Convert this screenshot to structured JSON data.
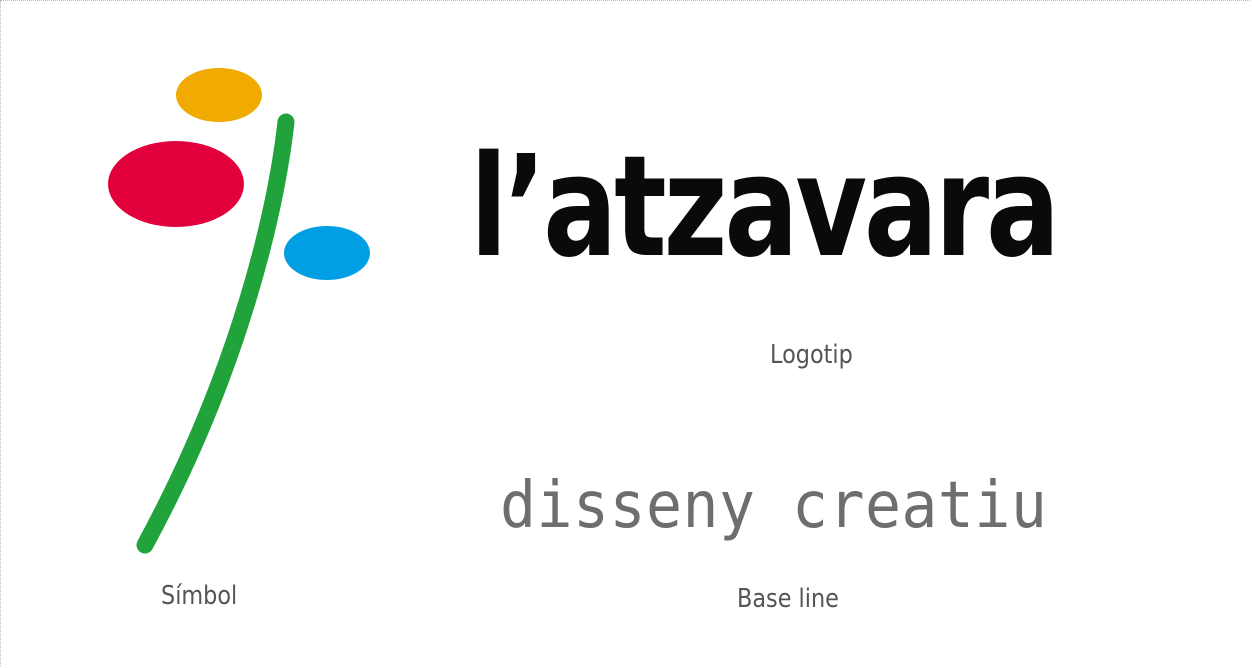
{
  "symbol": {
    "caption": "Símbol",
    "colors": {
      "top_ellipse": "#F0AA00",
      "left_ellipse": "#E1003C",
      "right_ellipse": "#009FE3",
      "stem": "#1FA33A"
    }
  },
  "logotip": {
    "wordmark": "l’atzavara",
    "caption": "Logotip"
  },
  "baseline": {
    "text": "disseny creatiu",
    "caption": "Base line"
  }
}
